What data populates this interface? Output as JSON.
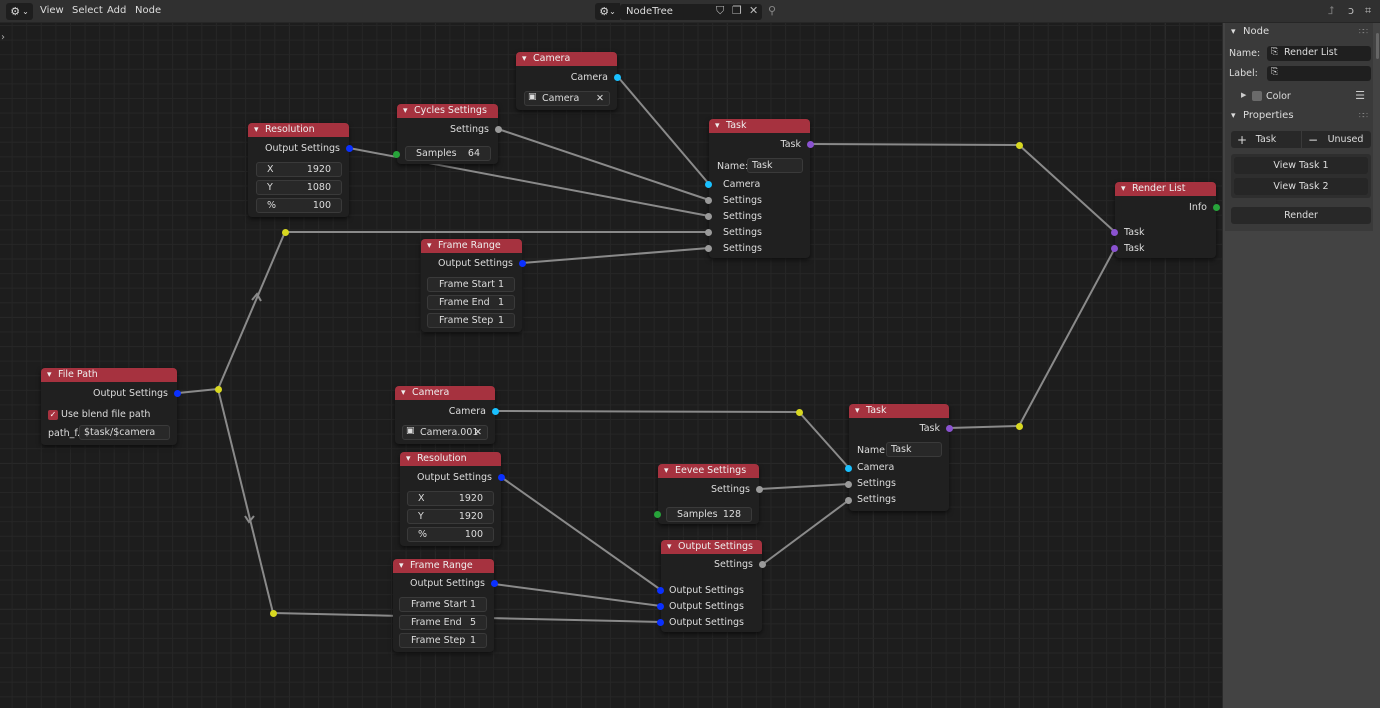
{
  "topbar": {
    "editor_icon": "node-editor-icon",
    "menus": [
      "View",
      "Select",
      "Add",
      "Node"
    ],
    "tree_name": "NodeTree",
    "icons": [
      "fake-user-shield-icon",
      "duplicate-icon",
      "close-icon",
      "pin-icon"
    ],
    "right_icons": [
      "parent-tree-icon",
      "snap-icon",
      "overlay-icon"
    ]
  },
  "nodes": {
    "camera1": {
      "title": "Camera",
      "output": "Camera",
      "value": "Camera"
    },
    "cycles": {
      "title": "Cycles Settings",
      "output": "Settings",
      "samples_label": "Samples",
      "samples": "64"
    },
    "resolution1": {
      "title": "Resolution",
      "output": "Output Settings",
      "fields": [
        {
          "label": "X",
          "value": "1920"
        },
        {
          "label": "Y",
          "value": "1080"
        },
        {
          "label": "%",
          "value": "100"
        }
      ]
    },
    "task1": {
      "title": "Task",
      "output": "Task",
      "name_label": "Name:",
      "name_value": "Task",
      "inputs": [
        "Camera",
        "Settings",
        "Settings",
        "Settings",
        "Settings"
      ]
    },
    "framerange1": {
      "title": "Frame Range",
      "output": "Output Settings",
      "fields": [
        {
          "label": "Frame Start",
          "value": "1"
        },
        {
          "label": "Frame End",
          "value": "1"
        },
        {
          "label": "Frame Step",
          "value": "1"
        }
      ]
    },
    "renderlist": {
      "title": "Render List",
      "output": "Info",
      "inputs": [
        "Task",
        "Task"
      ]
    },
    "filepath": {
      "title": "File Path",
      "output": "Output Settings",
      "checkbox_label": "Use blend file path",
      "checked": true,
      "path_label": "path_f...",
      "path_value": "$task/$camera"
    },
    "camera2": {
      "title": "Camera",
      "output": "Camera",
      "value": "Camera.001"
    },
    "resolution2": {
      "title": "Resolution",
      "output": "Output Settings",
      "fields": [
        {
          "label": "X",
          "value": "1920"
        },
        {
          "label": "Y",
          "value": "1920"
        },
        {
          "label": "%",
          "value": "100"
        }
      ]
    },
    "framerange2": {
      "title": "Frame Range",
      "output": "Output Settings",
      "fields": [
        {
          "label": "Frame Start",
          "value": "1"
        },
        {
          "label": "Frame End",
          "value": "5"
        },
        {
          "label": "Frame Step",
          "value": "1"
        }
      ]
    },
    "eevee": {
      "title": "Eevee Settings",
      "output": "Settings",
      "samples_label": "Samples",
      "samples": "128"
    },
    "outputsettings": {
      "title": "Output Settings",
      "output": "Settings",
      "inputs": [
        "Output Settings",
        "Output Settings",
        "Output Settings"
      ]
    },
    "task2": {
      "title": "Task",
      "output": "Task",
      "name_label": "Name:",
      "name_value": "Task",
      "inputs": [
        "Camera",
        "Settings",
        "Settings"
      ]
    }
  },
  "sidebar": {
    "node_panel": {
      "title": "Node",
      "name_label": "Name:",
      "name_value": "Render List",
      "label_label": "Label:",
      "label_value": "",
      "color_label": "Color"
    },
    "properties_panel": {
      "title": "Properties",
      "add_label": "Task",
      "remove_label": "Unused",
      "view_buttons": [
        "View Task 1",
        "View Task 2"
      ],
      "render_label": "Render"
    }
  },
  "colors": {
    "node_header": "#a6323f",
    "socket_settings": "#0a30ff",
    "socket_camera": "#19c0ff",
    "socket_task": "#8a52d0",
    "socket_int": "#27a33a",
    "reroute": "#d8d820"
  }
}
